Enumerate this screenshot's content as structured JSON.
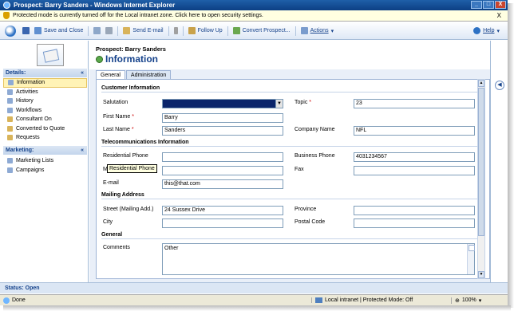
{
  "window": {
    "title": "Prospect: Barry Sanders - Windows Internet Explorer",
    "controls": [
      "_",
      "□",
      "X"
    ]
  },
  "infobar": {
    "text": "Protected mode is currently turned off for the Local intranet zone.  Click here to open security settings.",
    "close": "X"
  },
  "toolbar": {
    "save": "Save and Close",
    "send_email": "Send E-mail",
    "follow_up": "Follow Up",
    "convert": "Convert Prospect...",
    "actions": "Actions",
    "help": "Help"
  },
  "nav": {
    "details_header": "Details:",
    "details_items": [
      "Information",
      "Activities",
      "History",
      "Workflows",
      "Consultant On",
      "Converted to Quote",
      "Requests"
    ],
    "marketing_header": "Marketing:",
    "marketing_items": [
      "Marketing Lists",
      "Campaigns"
    ],
    "chevron": "«"
  },
  "header": {
    "record": "Prospect: Barry Sanders",
    "title": "Information"
  },
  "tabs": [
    "General",
    "Administration"
  ],
  "sections": {
    "customer": "Customer Information",
    "telecom": "Telecommunications Information",
    "mailing": "Mailing Address",
    "general": "General"
  },
  "labels": {
    "salutation": "Salutation",
    "first_name": "First Name",
    "last_name": "Last Name",
    "topic": "Topic",
    "company_name": "Company Name",
    "residential_phone": "Residential Phone",
    "mobile_phone": "Mo",
    "email": "E-mail",
    "business_phone": "Business Phone",
    "fax": "Fax",
    "street": "Street (Mailing Add.)",
    "city": "City",
    "province": "Province",
    "postal_code": "Postal Code",
    "comments": "Comments",
    "required": "*"
  },
  "values": {
    "salutation": "",
    "first_name": "Barry",
    "last_name": "Sanders",
    "topic": "23",
    "company_name": "NFL",
    "residential_phone": "",
    "mobile_phone": "",
    "email": "this@that.com",
    "business_phone": "4031234567",
    "fax": "",
    "street": "24 Sussex Drive",
    "city": "",
    "province": "",
    "postal_code": "",
    "comments": "Other"
  },
  "tooltip": "Residential Phone",
  "status": {
    "record_status": "Status: Open"
  },
  "ie_status": {
    "done": "Done",
    "zone": "Local intranet | Protected Mode: Off",
    "zoom": "100%"
  }
}
